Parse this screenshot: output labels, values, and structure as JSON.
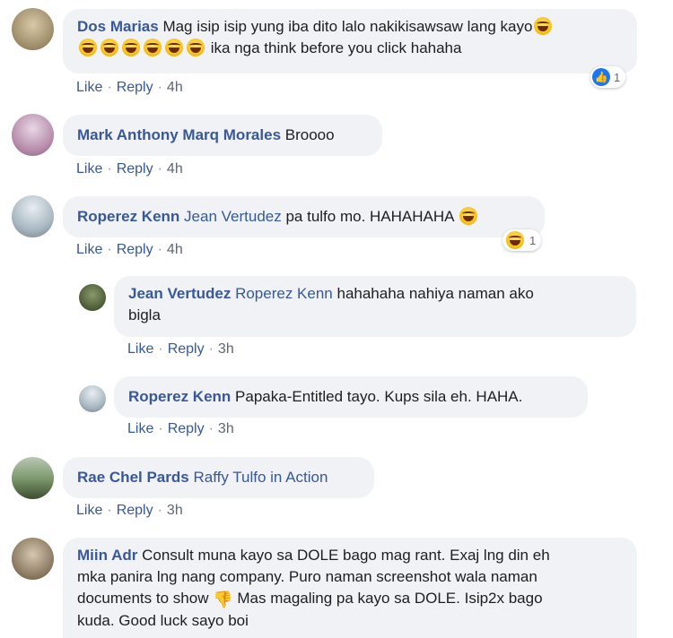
{
  "comments": [
    {
      "author": "Dos Marias",
      "line1": "Mag isip isip yung iba dito lalo nakikisawsaw lang kayo",
      "line2": "ika nga think before you click hahaha",
      "like": "Like",
      "reply": "Reply",
      "time": "4h",
      "reaction_count": "1",
      "reaction_icon": "like-icon"
    },
    {
      "author": "Mark Anthony Marq Morales",
      "text": "Broooo",
      "like": "Like",
      "reply": "Reply",
      "time": "4h"
    },
    {
      "author": "Roperez Kenn",
      "mention": "Jean Vertudez",
      "text": "pa tulfo mo. HAHAHAHA",
      "like": "Like",
      "reply": "Reply",
      "time": "4h",
      "reaction_count": "1",
      "reaction_icon": "haha-icon"
    },
    {
      "author": "Jean Vertudez",
      "mention": "Roperez Kenn",
      "text": "hahahaha nahiya naman ako",
      "text2": "bigla",
      "like": "Like",
      "reply": "Reply",
      "time": "3h"
    },
    {
      "author": "Roperez Kenn",
      "text": "Papaka-Entitled tayo. Kups sila eh. HAHA.",
      "like": "Like",
      "reply": "Reply",
      "time": "3h"
    },
    {
      "author": "Rae Chel Pards",
      "mention": "Raffy Tulfo in Action",
      "like": "Like",
      "reply": "Reply",
      "time": "3h"
    },
    {
      "author": "Miin Adr",
      "line1": "Consult muna kayo sa DOLE bago mag rant. Exaj lng din eh",
      "line2": "mka panira lng nang company. Puro naman screenshot wala naman",
      "line3a": "documents to show",
      "line3b": "Mas magaling pa kayo sa DOLE. Isip2x bago",
      "line4": "kuda. Good luck sayo boi"
    }
  ]
}
